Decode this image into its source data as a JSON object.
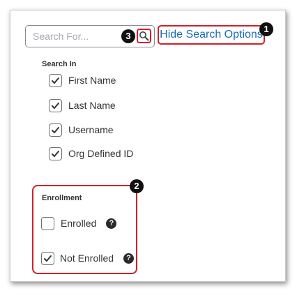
{
  "search": {
    "placeholder": "Search For...",
    "hide_options_label": "Hide Search Options"
  },
  "search_in": {
    "heading": "Search In",
    "options": [
      {
        "label": "First Name",
        "checked": true
      },
      {
        "label": "Last Name",
        "checked": true
      },
      {
        "label": "Username",
        "checked": true
      },
      {
        "label": "Org Defined ID",
        "checked": true
      }
    ]
  },
  "enrollment": {
    "heading": "Enrollment",
    "options": [
      {
        "label": "Enrolled",
        "checked": false,
        "help": "?"
      },
      {
        "label": "Not Enrolled",
        "checked": true,
        "help": "?"
      }
    ]
  },
  "callouts": [
    "1",
    "2",
    "3"
  ],
  "colors": {
    "highlight": "#d0202a",
    "link": "#1a6cb0",
    "callout_bg": "#111111"
  },
  "icons": {
    "search": "magnifier-icon",
    "check": "checkmark-icon",
    "help": "question-circle-icon"
  }
}
